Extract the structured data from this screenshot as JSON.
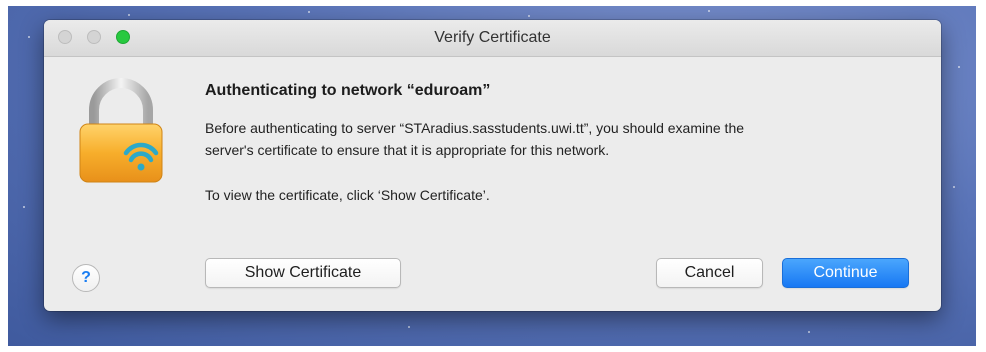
{
  "window": {
    "title": "Verify Certificate"
  },
  "dialog": {
    "heading": "Authenticating to network “eduroam”",
    "message_line1": "Before authenticating to server “STAradius.sasstudents.uwi.tt”, you should examine the",
    "message_line2": "server's certificate to ensure that it is appropriate for this network.",
    "instruction": "To view the certificate, click ‘Show Certificate’.",
    "icon": "lock-wifi-icon"
  },
  "buttons": {
    "help_label": "?",
    "show_certificate": "Show Certificate",
    "cancel": "Cancel",
    "continue": "Continue"
  },
  "colors": {
    "primary_button": "#1878f3",
    "zoom_button": "#27c93f",
    "lock_body": "#f5a623"
  }
}
